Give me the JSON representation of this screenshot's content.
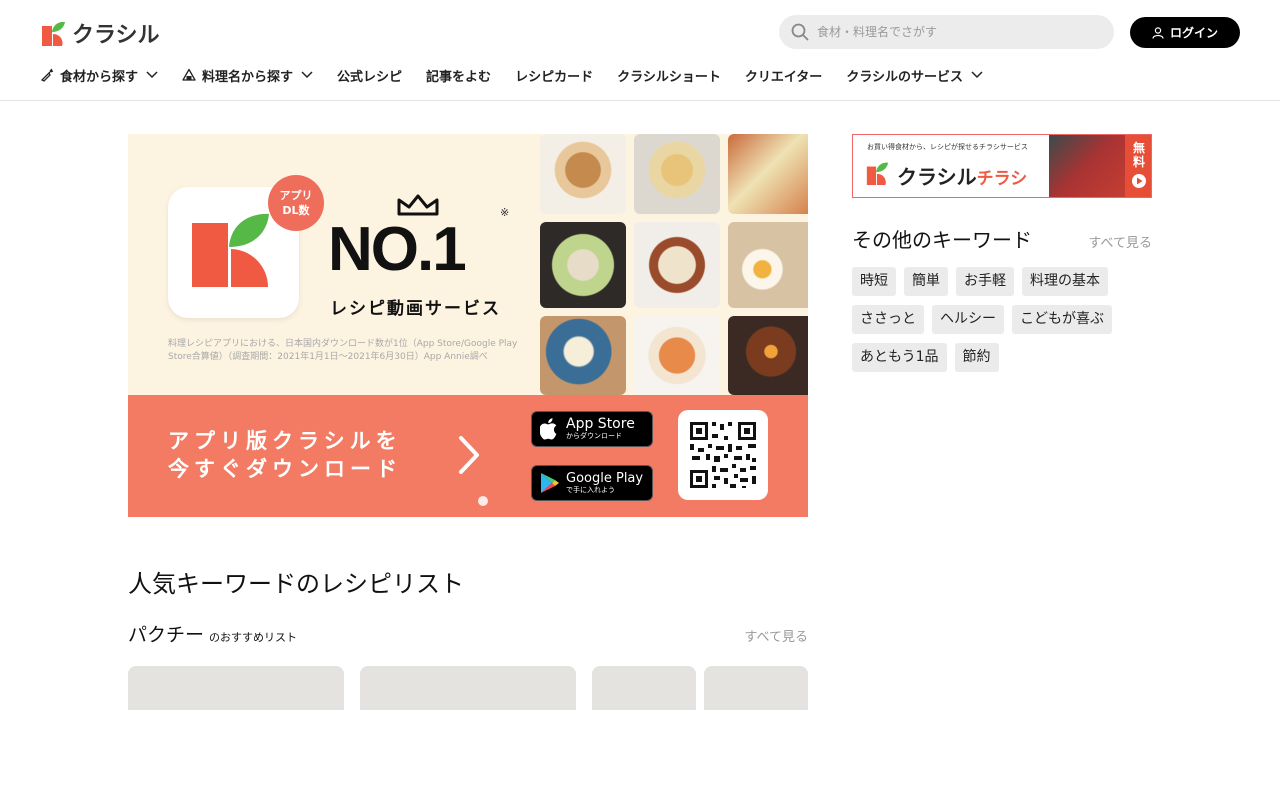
{
  "brand": {
    "name": "クラシル",
    "accent": "#f05a43",
    "leaf": "#56b947"
  },
  "search": {
    "placeholder": "食材・料理名でさがす"
  },
  "login": {
    "label": "ログイン"
  },
  "nav": [
    {
      "label": "食材から探す",
      "icon": "carrot-icon",
      "dropdown": true
    },
    {
      "label": "料理名から探す",
      "icon": "rice-ball-icon",
      "dropdown": true
    },
    {
      "label": "公式レシピ",
      "dropdown": false
    },
    {
      "label": "記事をよむ",
      "dropdown": false
    },
    {
      "label": "レシピカード",
      "dropdown": false
    },
    {
      "label": "クラシルショート",
      "dropdown": false
    },
    {
      "label": "クリエイター",
      "dropdown": false
    },
    {
      "label": "クラシルのサービス",
      "dropdown": true
    }
  ],
  "hero": {
    "badge_line1": "アプリ",
    "badge_line2": "DL数",
    "headline": "NO.1",
    "headline_mark": "※",
    "subline": "レシピ動画サービス",
    "fineprint": "料理レシピアプリにおける、日本国内ダウンロード数が1位（App Store/Google Play Store合算値）（調査期間：2021年1月1日〜2021年6月30日）App Annie調べ",
    "cta_line1": "アプリ版クラシルを",
    "cta_line2": "今すぐダウンロード",
    "appstore_big": "App Store",
    "appstore_small": "からダウンロード",
    "googleplay_big": "Google Play",
    "googleplay_small": "で手に入れよう"
  },
  "popular": {
    "title": "人気キーワードのレシピリスト",
    "keyword": "パクチー",
    "keyword_sub": "のおすすめリスト",
    "see_all": "すべて見る"
  },
  "sidebar": {
    "banner_top": "お買い得食材から、レシピが探せるチラシサービス",
    "banner_brand": "クラシル",
    "banner_sub": "チラシ",
    "banner_free": "無料",
    "title": "その他のキーワード",
    "see_all": "すべて見る",
    "tags": [
      "時短",
      "簡単",
      "お手軽",
      "料理の基本",
      "ささっと",
      "ヘルシー",
      "こどもが喜ぶ",
      "あともう1品",
      "節約"
    ]
  }
}
